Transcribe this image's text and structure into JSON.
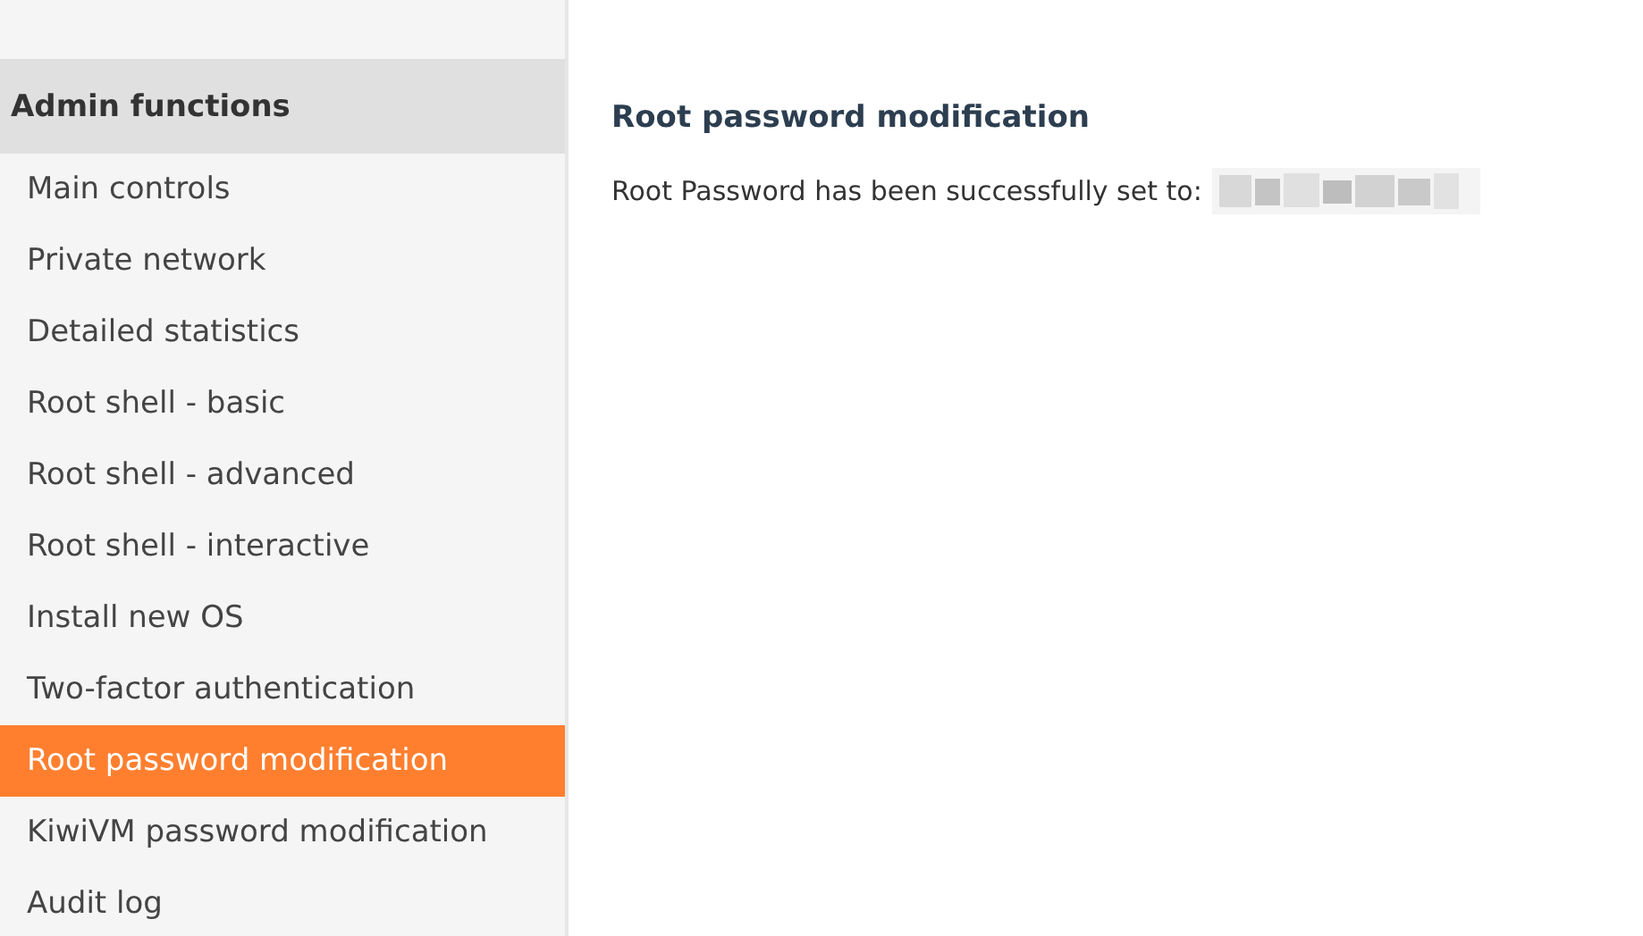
{
  "sidebar": {
    "title": "Admin functions",
    "items": [
      {
        "label": "Main controls",
        "selected": false
      },
      {
        "label": "Private network",
        "selected": false
      },
      {
        "label": "Detailed statistics",
        "selected": false
      },
      {
        "label": "Root shell - basic",
        "selected": false
      },
      {
        "label": "Root shell - advanced",
        "selected": false
      },
      {
        "label": "Root shell - interactive",
        "selected": false
      },
      {
        "label": "Install new OS",
        "selected": false
      },
      {
        "label": "Two-factor authentication",
        "selected": false
      },
      {
        "label": "Root password modification",
        "selected": true
      },
      {
        "label": "KiwiVM password modification",
        "selected": false
      },
      {
        "label": "Audit log",
        "selected": false
      }
    ]
  },
  "main": {
    "heading": "Root password modification",
    "message": "Root Password has been successfully set to:"
  }
}
